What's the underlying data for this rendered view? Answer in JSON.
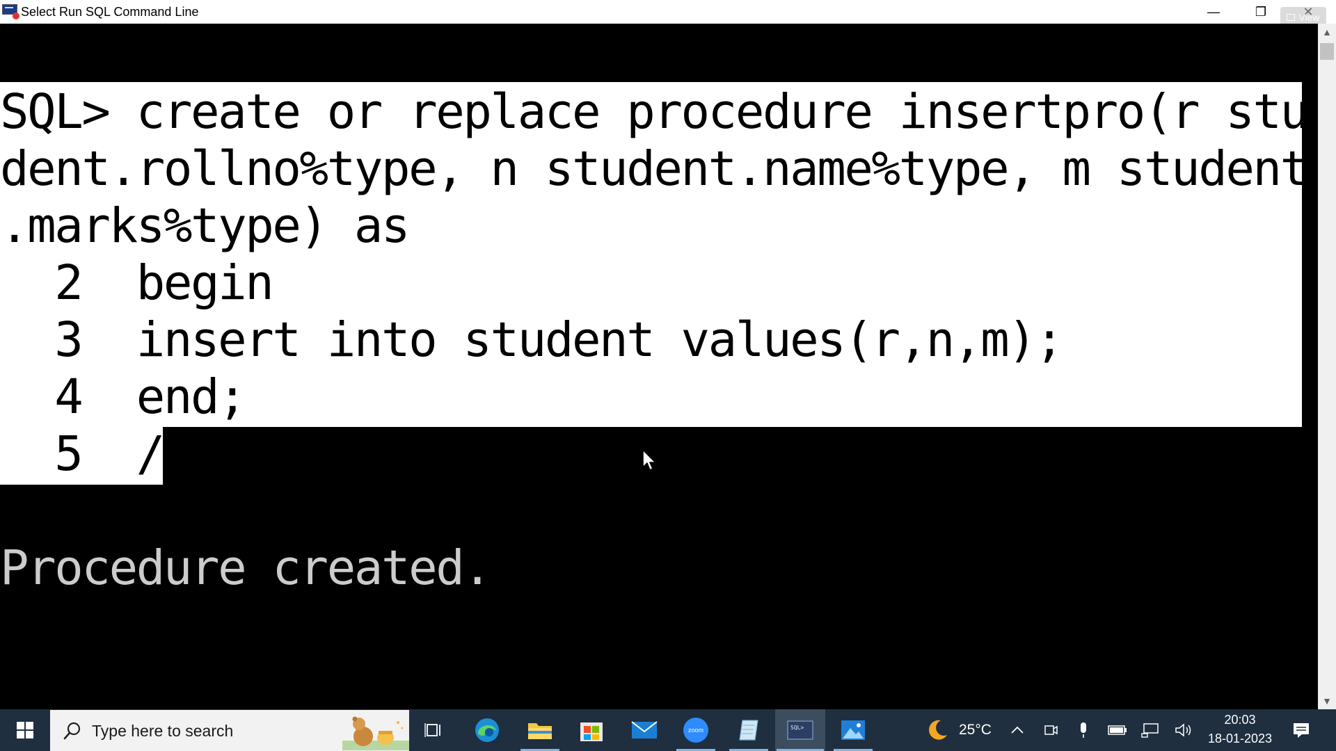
{
  "window": {
    "title": "Select Run SQL Command Line",
    "minimize_glyph": "—",
    "restore_glyph": "❐",
    "close_glyph": "✕",
    "view_overlay_label": "View"
  },
  "console": {
    "lines": [
      "SQL> create or replace procedure insertpro(r stu",
      "dent.rollno%type, n student.name%type, m student",
      ".marks%type) as",
      "  2  begin",
      "  3  insert into student values(r,n,m);",
      "  4  end;",
      "  5  /"
    ],
    "result": "Procedure created."
  },
  "taskbar": {
    "search_placeholder": "Type here to search",
    "apps": [
      {
        "name": "task-view",
        "icon": "task-view-icon"
      },
      {
        "name": "edge",
        "icon": "edge-icon"
      },
      {
        "name": "file-explorer",
        "icon": "folder-icon"
      },
      {
        "name": "microsoft-store",
        "icon": "store-icon"
      },
      {
        "name": "mail",
        "icon": "mail-icon"
      },
      {
        "name": "zoom",
        "icon": "zoom-icon"
      },
      {
        "name": "notepad",
        "icon": "notepad-icon"
      },
      {
        "name": "sql-command-line",
        "icon": "sql-terminal-icon"
      },
      {
        "name": "photos",
        "icon": "photos-icon"
      }
    ],
    "zoom_label": "zoom",
    "sql_label": "SQL>",
    "weather": {
      "icon": "moon-icon",
      "temperature": "25°C"
    },
    "clock": {
      "time": "20:03",
      "date": "18-01-2023"
    }
  },
  "colors": {
    "console_bg": "#000000",
    "console_fg": "#cccccc",
    "selection_bg": "#ffffff",
    "taskbar_bg": "#1f2f3f",
    "accent": "#8ab4d8"
  }
}
